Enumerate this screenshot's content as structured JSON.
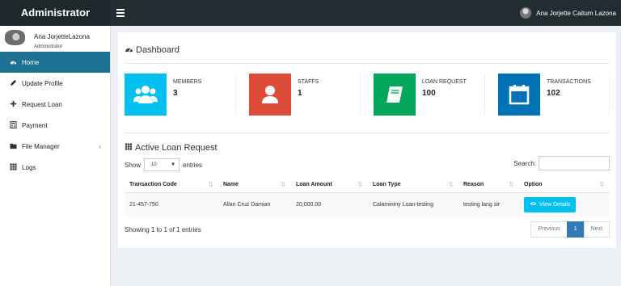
{
  "brand": {
    "title": "Administrator"
  },
  "topbar": {
    "user_name": "Ana Jorjette Caitum Lazona"
  },
  "sidebar": {
    "user_name": "Ana JorjetteLazona",
    "user_role": "Administrator",
    "items": [
      {
        "label": "Home",
        "icon": "dashboard-icon",
        "active": true
      },
      {
        "label": "Update Profile",
        "icon": "pencil-icon"
      },
      {
        "label": "Request Loan",
        "icon": "plus-icon"
      },
      {
        "label": "Payment",
        "icon": "calculator-icon"
      },
      {
        "label": "File Manager",
        "icon": "folder-icon"
      },
      {
        "label": "Logs",
        "icon": "grid-icon"
      }
    ]
  },
  "dashboard": {
    "title": "Dashboard"
  },
  "cards": [
    {
      "label": "MEMBERS",
      "value": "3",
      "color": "#00c0ef",
      "icon": "users-icon"
    },
    {
      "label": "STAFFS",
      "value": "1",
      "color": "#dd4b39",
      "icon": "user-icon"
    },
    {
      "label": "LOAN REQUEST",
      "value": "100",
      "color": "#00a65a",
      "icon": "book-icon"
    },
    {
      "label": "TRANSACTIONS",
      "value": "102",
      "color": "#0073b7",
      "icon": "calendar-icon"
    }
  ],
  "loans": {
    "title": "Active Loan Request",
    "show_label": "Show",
    "show_value": "10",
    "entries_label": "entries",
    "search_label": "Search:",
    "columns": [
      "Transaction Code",
      "Name",
      "Loan Amount",
      "Loan Type",
      "Reason",
      "Option"
    ],
    "rows": [
      {
        "code": "21-457-750",
        "name": "Allan Cruz Damian",
        "amount": "20,000.00",
        "type": "Calamininy Loan-testing",
        "reason": "testing lang sir",
        "option": "View Details"
      }
    ],
    "info": "Showing 1 to 1 of 1 entries",
    "pagination": {
      "previous": "Previous",
      "current": "1",
      "next": "Next"
    }
  }
}
